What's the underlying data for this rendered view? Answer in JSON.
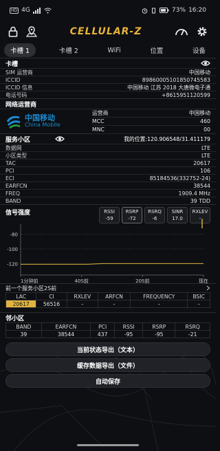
{
  "status_bar": {
    "hd": "HD",
    "network": "4G",
    "battery": "73%",
    "time": "16:20"
  },
  "toolbar": {
    "app_title": "CELLULAR-Z"
  },
  "tabs": [
    {
      "label": "卡槽 1"
    },
    {
      "label": "卡槽 2"
    },
    {
      "label": "WiFi"
    },
    {
      "label": "位置"
    },
    {
      "label": "设备"
    }
  ],
  "sim": {
    "title": "卡槽",
    "rows": [
      {
        "k": "SIM 运营商",
        "v": "中国移动"
      },
      {
        "k": "ICCID",
        "v": "89860005101850745583"
      },
      {
        "k": "ICCID 信息",
        "v": "中国移动 江苏 2018 大唐微电子通"
      },
      {
        "k": "电话号码",
        "v": "+8615951120599"
      }
    ]
  },
  "operator": {
    "title": "网络运营商",
    "logo_cn": "中国移动",
    "logo_en": "China Mobile",
    "rows": [
      {
        "k": "运营商",
        "v": "中国移动"
      },
      {
        "k": "MCC",
        "v": "460"
      },
      {
        "k": "MNC",
        "v": "00"
      }
    ]
  },
  "serving": {
    "title": "服务小区",
    "location": "我的位置:120.906548/31.411179",
    "rows": [
      {
        "k": "数据网",
        "v": "LTE"
      },
      {
        "k": "小区类型",
        "v": "LTE"
      },
      {
        "k": "TAC",
        "v": "20617"
      },
      {
        "k": "PCI",
        "v": "106"
      },
      {
        "k": "ECI",
        "v": "85184536(332752-24)"
      },
      {
        "k": "EARFCN",
        "v": "38544"
      },
      {
        "k": "FREQ",
        "v": "1909.4 MHz"
      },
      {
        "k": "BAND",
        "v": "39 TDD"
      }
    ]
  },
  "signal": {
    "title": "信号强度",
    "meters": [
      {
        "name": "RSSI",
        "value": "-59"
      },
      {
        "name": "RSRP",
        "value": "-72"
      },
      {
        "name": "RSRQ",
        "value": "-6"
      },
      {
        "name": "SINR",
        "value": "17.0"
      },
      {
        "name": "RXLEV",
        "value": "-"
      }
    ]
  },
  "chart_data": {
    "type": "line",
    "title": "",
    "ylim": [
      -130,
      -70
    ],
    "yticks": [
      -80,
      -100,
      -120
    ],
    "xticks": [
      "1分钟前",
      "40S前",
      "20S前",
      "现在"
    ],
    "series": [
      {
        "x": [
          60,
          38,
          33,
          0
        ],
        "y": [
          -121,
          -121,
          -120,
          -120
        ]
      }
    ],
    "current_marker": [
      -72,
      -59
    ]
  },
  "prev_serving": {
    "title": "前一个服务小区2S前",
    "headers": [
      "LAC",
      "CI",
      "RXLEV",
      "ARFCN",
      "FREQUENCY",
      "BSIC"
    ],
    "values": [
      "20617",
      "56516",
      "-",
      "-",
      "-",
      "-"
    ]
  },
  "neighbors": {
    "title": "邻小区",
    "headers": [
      "BAND",
      "EARFCN",
      "PCI",
      "RSSI",
      "RSRP",
      "RSRQ"
    ],
    "values": [
      "39",
      "38544",
      "437",
      "-95",
      "-95",
      "-21"
    ]
  },
  "buttons": {
    "export_status": "当前状态导出（文本）",
    "export_cache": "缓存数据导出（文件）",
    "autosave": "自动保存"
  },
  "colors": {
    "accent": "#e0b340",
    "logo_blue": "#1b8ad0"
  }
}
